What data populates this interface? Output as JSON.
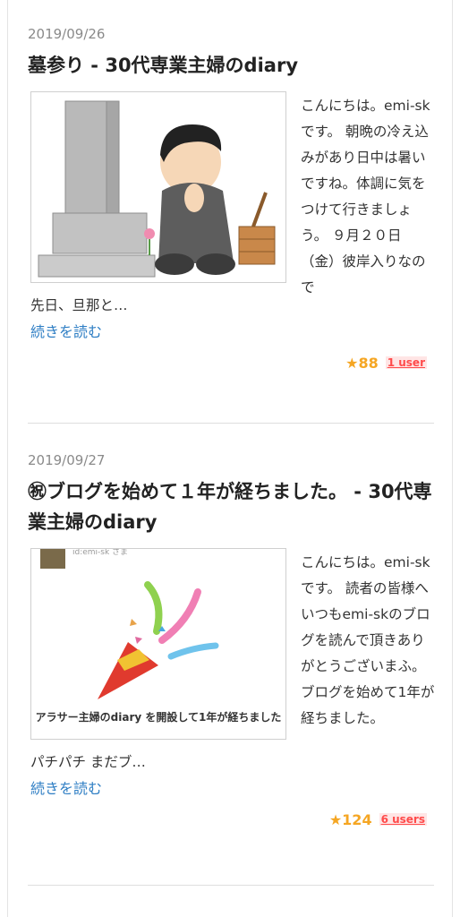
{
  "entries": [
    {
      "date": "2019/09/26",
      "title": "墓参り - 30代専業主婦のdiary",
      "excerpt_side": "こんにちは。emi-skです。 朝晩の冷え込みがあり日中は暑いですね。体調に気をつけて行きましょう。 ９月２０日（金）彼岸入りなので",
      "excerpt_tail": "先日、旦那と…",
      "read_more": "続きを読む",
      "stars": "★88",
      "users": "1 user"
    },
    {
      "date": "2019/09/27",
      "title": "㊗ブログを始めて１年が経ちました。 - 30代専業主婦のdiary",
      "excerpt_side": "こんにちは。emi-skです。 読者の皆様へ いつもemi-skのブログを読んで頂きありがとうございまふ。 ブログを始めて1年が経ちました。",
      "excerpt_tail": "パチパチ まだブ…",
      "read_more": "続きを読む",
      "stars": "★124",
      "users": "6 users",
      "thumb_caption": "アラサー主婦のdiary を開設して1年が経ちました",
      "thumb_header": "id:emi-sk さま"
    }
  ]
}
